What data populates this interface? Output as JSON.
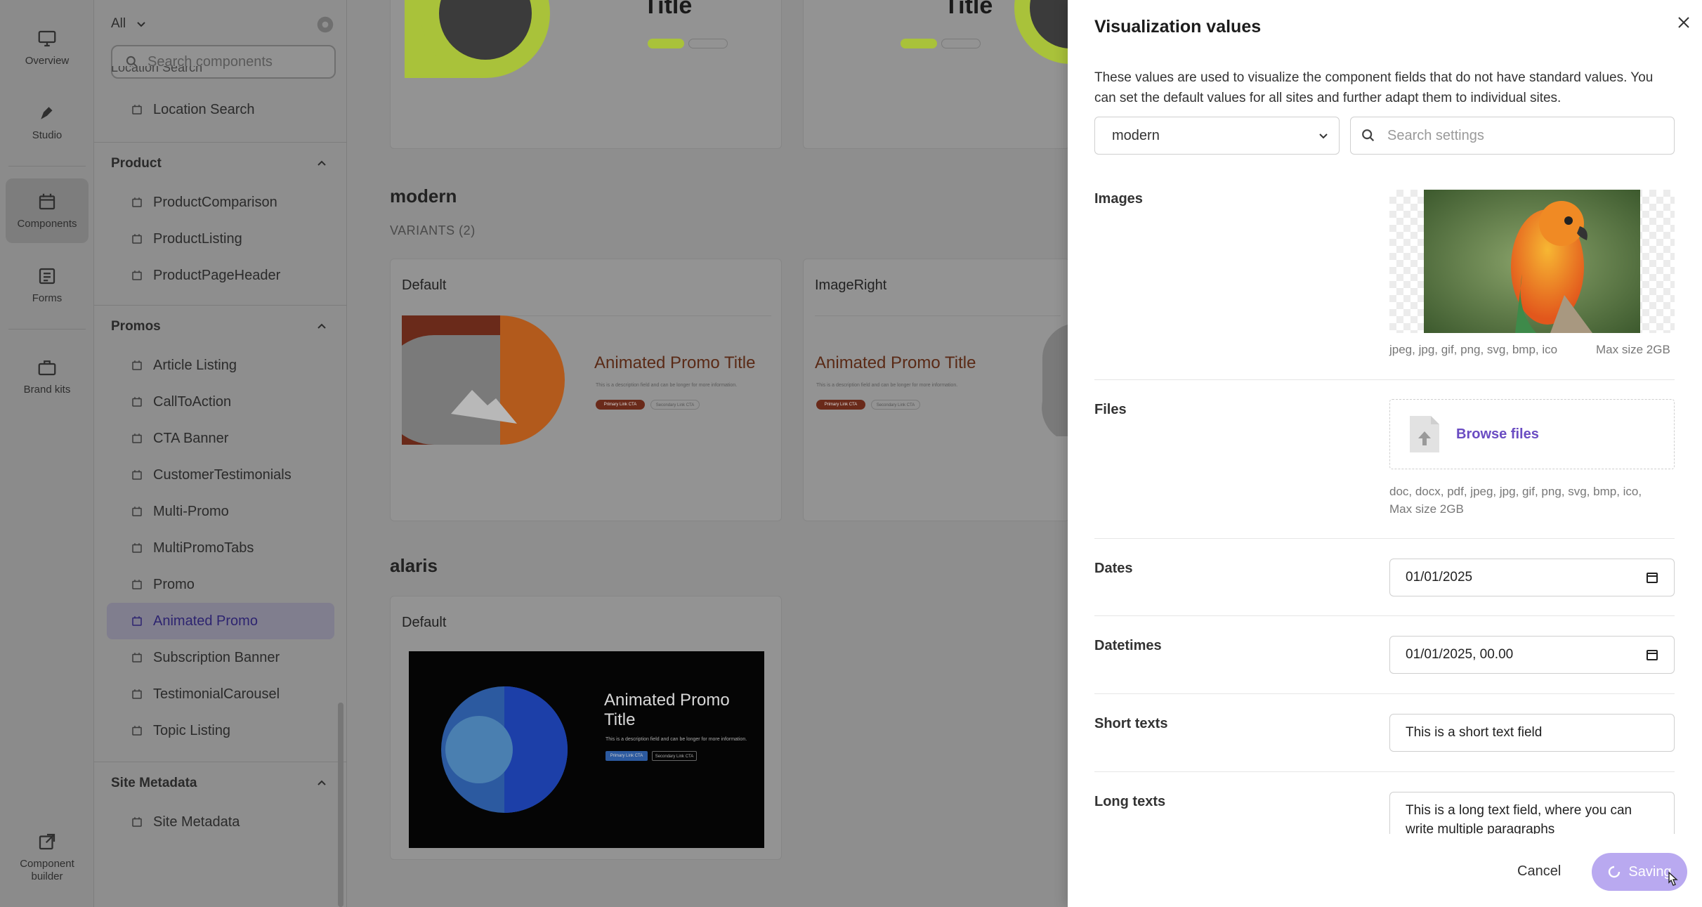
{
  "rail": {
    "items": [
      {
        "label": "Overview",
        "icon": "monitor-icon"
      },
      {
        "label": "Studio",
        "icon": "pen-icon"
      },
      {
        "label": "Components",
        "icon": "calendar-icon"
      },
      {
        "label": "Forms",
        "icon": "list-icon"
      },
      {
        "label": "Brand kits",
        "icon": "briefcase-icon"
      },
      {
        "label": "Component builder",
        "icon": "external-link-icon"
      }
    ]
  },
  "sidebar": {
    "filter": "All",
    "search_placeholder": "Search components",
    "partial_item": "Location Search",
    "location_item": "Location Search",
    "groups": [
      {
        "title": "Product",
        "items": [
          "ProductComparison",
          "ProductListing",
          "ProductPageHeader"
        ]
      },
      {
        "title": "Promos",
        "items": [
          "Article Listing",
          "CallToAction",
          "CTA Banner",
          "CustomerTestimonials",
          "Multi-Promo",
          "MultiPromoTabs",
          "Promo",
          "Animated Promo",
          "Subscription Banner",
          "TestimonialCarousel",
          "Topic Listing"
        ]
      },
      {
        "title": "Site Metadata",
        "items": [
          "Site Metadata"
        ]
      }
    ],
    "active_item": "Animated Promo"
  },
  "main": {
    "top_title_fragment": "Title",
    "sections": [
      {
        "name": "modern",
        "variants": "VARIANTS (2)",
        "cards": [
          "Default",
          "ImageRight"
        ]
      },
      {
        "name": "alaris",
        "cards": [
          "Default"
        ]
      }
    ],
    "promo_title": "Animated Promo Title",
    "promo_title_line1": "Animated Promo",
    "promo_title_line2": "Title",
    "promo_desc": "This is a description field and can be longer for more information.",
    "primary_cta": "Primary Link CTA",
    "secondary_cta": "Secondary Link CTA"
  },
  "drawer": {
    "title": "Visualization values",
    "description": "These values are used to visualize the component fields that do not have standard values. You can set the default values for all sites and further adapt them to individual sites.",
    "site_select": "modern",
    "search_placeholder": "Search settings",
    "images": {
      "label": "Images",
      "formats": "jpeg, jpg, gif, png, svg, bmp, ico",
      "max": "Max size 2GB"
    },
    "files": {
      "label": "Files",
      "browse": "Browse files",
      "formats": "doc, docx, pdf, jpeg, jpg, gif, png, svg, bmp, ico,",
      "max": "Max size 2GB"
    },
    "dates": {
      "label": "Dates",
      "value": "01/01/2025"
    },
    "datetimes": {
      "label": "Datetimes",
      "value": "01/01/2025, 00.00"
    },
    "short_texts": {
      "label": "Short texts",
      "value": "This is a short text field"
    },
    "long_texts": {
      "label": "Long texts",
      "value": "This is a long text field, where you can write multiple paragraphs"
    },
    "cancel": "Cancel",
    "saving": "Saving"
  },
  "colors": {
    "accent": "#6a4cc2",
    "saving_button": "#b9a9f0",
    "overlay": "#8e8e8e"
  }
}
